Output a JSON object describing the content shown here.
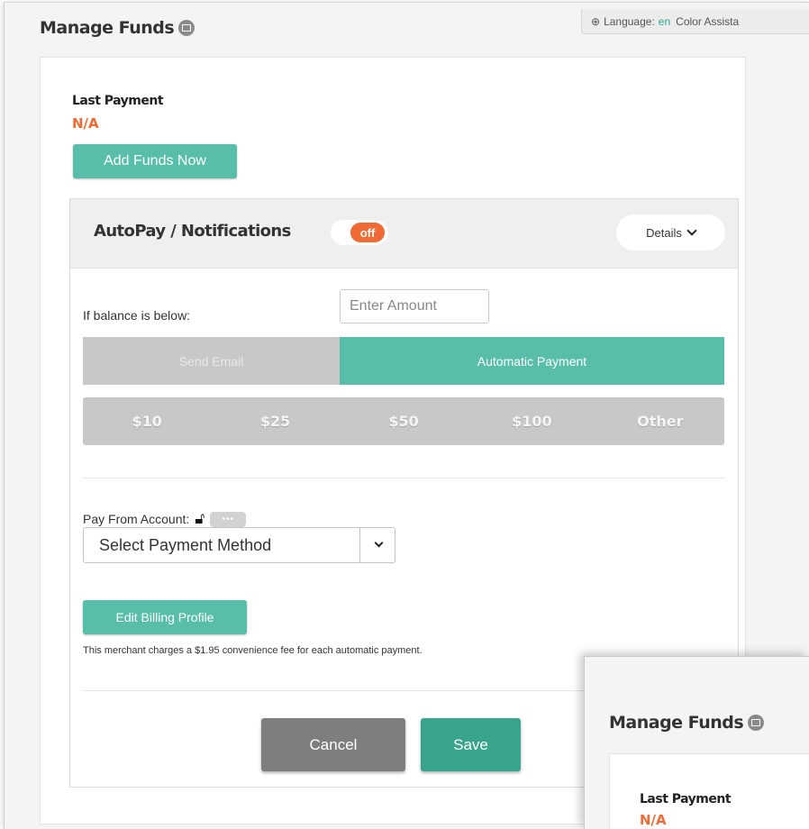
{
  "main": {
    "title": "Manage Funds",
    "title_icon": "video-icon",
    "language_bar": {
      "globe_icon": "globe-icon",
      "label": "Language:",
      "code": "en",
      "color_assist": "Color Assista"
    },
    "last_payment_label": "Last Payment",
    "last_payment_value": "N/A",
    "add_funds_label": "Add Funds Now",
    "autopay": {
      "title": "AutoPay / Notifications",
      "toggle_state": "off",
      "details_label": "Details",
      "balance_label": "If balance is below:",
      "amount_placeholder": "Enter Amount",
      "segments": {
        "send_email": "Send Email",
        "automatic_payment": "Automatic Payment",
        "selected": "Automatic Payment"
      },
      "amounts": [
        "$10",
        "$25",
        "$50",
        "$100",
        "Other"
      ],
      "pay_from_label": "Pay From Account:",
      "select_value": "Select Payment Method",
      "edit_billing_label": "Edit Billing Profile",
      "fee_note": "This merchant charges a $1.95 convenience fee for each automatic payment.",
      "cancel_label": "Cancel",
      "save_label": "Save"
    }
  },
  "overlay": {
    "title": "Manage Funds",
    "last_payment_label": "Last Payment",
    "last_payment_value": "N/A"
  },
  "colors": {
    "accent_teal": "#58bea9",
    "save_teal": "#38a48b",
    "orange": "#f06a35",
    "gray_button": "#7e7e7e",
    "segment_gray": "#c8c8c8"
  }
}
